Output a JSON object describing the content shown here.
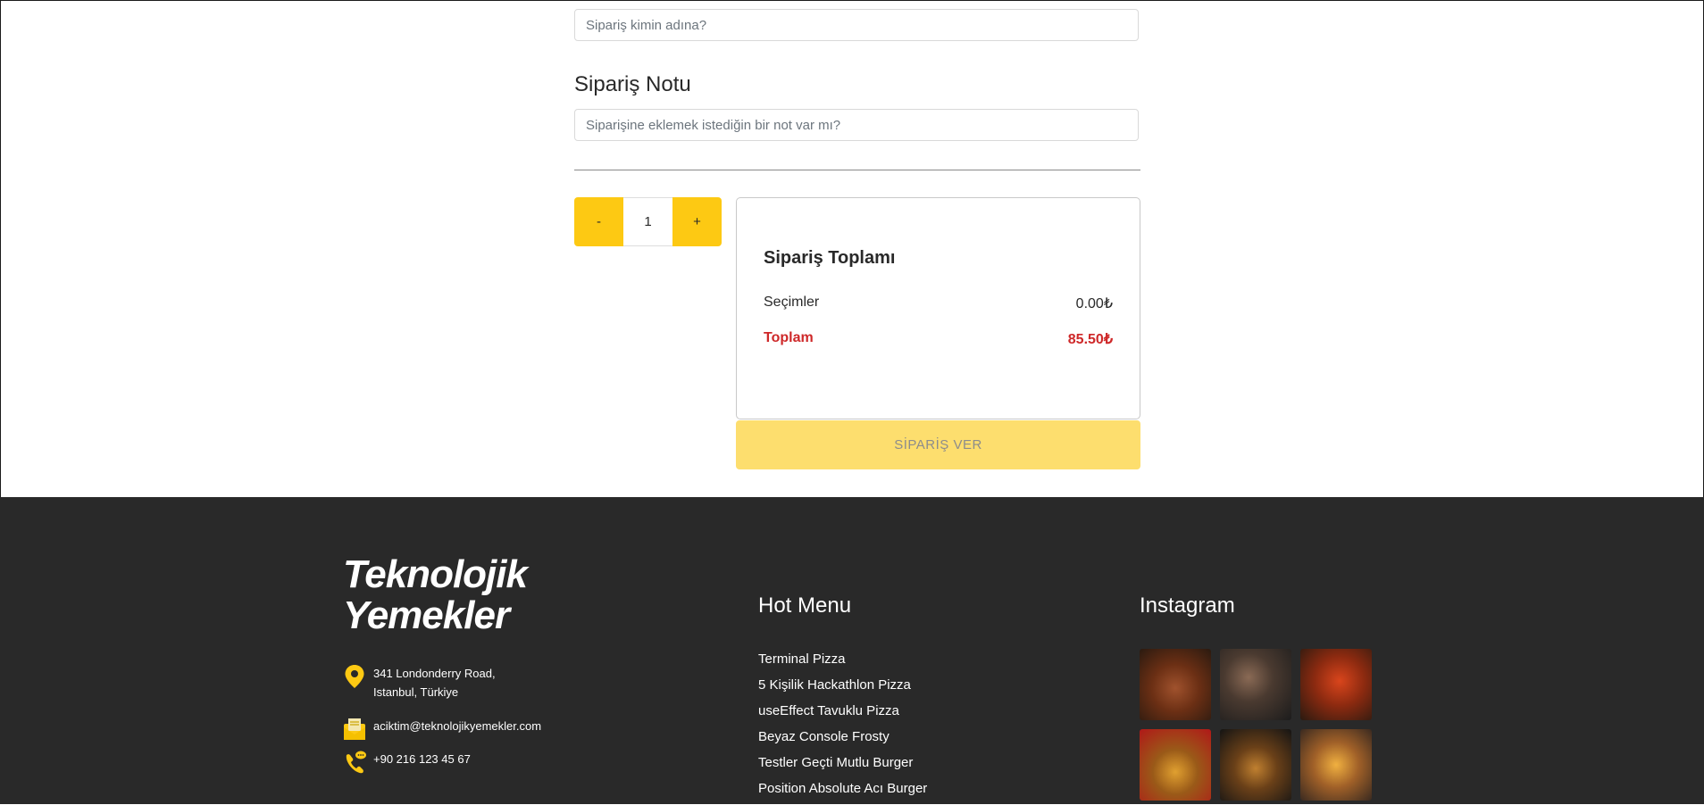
{
  "order_form": {
    "name_placeholder": "Sipariş kimin adına?",
    "note_title": "Sipariş Notu",
    "note_placeholder": "Siparişine eklemek istediğin bir not var mı?"
  },
  "quantity": {
    "minus_label": "-",
    "value": "1",
    "plus_label": "+"
  },
  "summary": {
    "title": "Sipariş Toplamı",
    "selections_label": "Seçimler",
    "selections_value": "0.00₺",
    "total_label": "Toplam",
    "total_value": "85.50₺"
  },
  "order_button_label": "SİPARİŞ VER",
  "footer": {
    "logo_line1": "Teknolojik",
    "logo_line2": "Yemekler",
    "address_line1": "341 Londonderry Road,",
    "address_line2": "Istanbul, Türkiye",
    "email": "aciktim@teknolojikyemekler.com",
    "phone": "+90 216 123 45 67",
    "hot_menu_title": "Hot Menu",
    "hot_menu_items": [
      "Terminal Pizza",
      "5 Kişilik Hackathlon Pizza",
      "useEffect Tavuklu Pizza",
      "Beyaz Console Frosty",
      "Testler Geçti Mutlu Burger",
      "Position Absolute Acı Burger"
    ],
    "instagram_title": "Instagram"
  },
  "colors": {
    "accent_yellow": "#FDC913",
    "disabled_yellow": "#FDDE6E",
    "total_red": "#CE2829",
    "footer_bg": "#292929"
  }
}
